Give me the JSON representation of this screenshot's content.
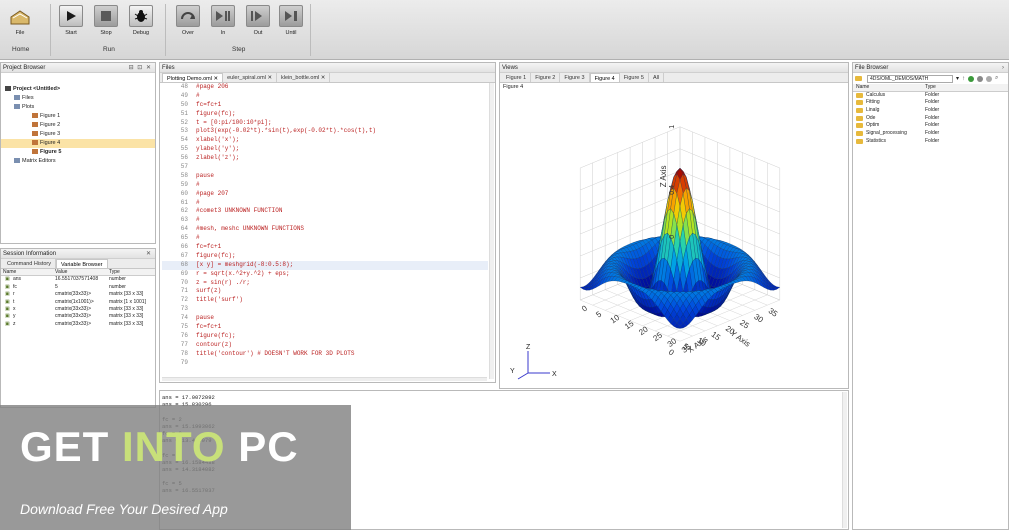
{
  "ribbon": {
    "buttons": [
      {
        "label": "File"
      },
      {
        "label": "Start"
      },
      {
        "label": "Stop"
      },
      {
        "label": "Debug"
      },
      {
        "label": "Over"
      },
      {
        "label": "In"
      },
      {
        "label": "Out"
      },
      {
        "label": "Until"
      }
    ],
    "groups": {
      "home": "Home",
      "run": "Run",
      "step": "Step"
    }
  },
  "project_browser": {
    "title": "Project Browser",
    "tree": [
      {
        "label": "Project <Untitled>",
        "bold": true,
        "depth": 0
      },
      {
        "label": "Files",
        "depth": 1
      },
      {
        "label": "Plots",
        "depth": 1
      },
      {
        "label": "Figure 1",
        "depth": 3
      },
      {
        "label": "Figure 2",
        "depth": 3
      },
      {
        "label": "Figure 3",
        "depth": 3
      },
      {
        "label": "Figure 4",
        "depth": 3,
        "selected": true
      },
      {
        "label": "Figure 5",
        "depth": 3,
        "bold": true
      },
      {
        "label": "Matrix Editors",
        "depth": 1
      }
    ]
  },
  "session": {
    "title": "Session Information",
    "tabs": [
      "Command History",
      "Variable Browser"
    ],
    "columns": [
      "Name",
      "Value",
      "Type"
    ],
    "rows": [
      {
        "name": "ans",
        "value": "16.5517037571408",
        "type": "number"
      },
      {
        "name": "fc",
        "value": "5",
        "type": "number"
      },
      {
        "name": "r",
        "value": "cmatrix(33x33)>",
        "type": "matrix [33 x 33]"
      },
      {
        "name": "t",
        "value": "cmatrix(1x1001)>",
        "type": "matrix [1 x 1001]"
      },
      {
        "name": "x",
        "value": "cmatrix(33x33)>",
        "type": "matrix [33 x 33]"
      },
      {
        "name": "y",
        "value": "cmatrix(33x33)>",
        "type": "matrix [33 x 33]"
      },
      {
        "name": "z",
        "value": "cmatrix(33x33)>",
        "type": "matrix [33 x 33]"
      }
    ]
  },
  "files": {
    "title": "Files",
    "tabs": [
      "Plotting Demo.oml",
      "euler_spiral.oml",
      "klein_bottle.oml"
    ],
    "lines": [
      {
        "n": "48",
        "t": "#page 206"
      },
      {
        "n": "49",
        "t": "#"
      },
      {
        "n": "50",
        "t": "fc=fc+1"
      },
      {
        "n": "51",
        "t": "figure(fc);"
      },
      {
        "n": "52",
        "t": "t = [0:pi/100:10*pi];"
      },
      {
        "n": "53",
        "t": "plot3(exp(-0.02*t).*sin(t),exp(-0.02*t).*cos(t),t)"
      },
      {
        "n": "54",
        "t": "xlabel('x');"
      },
      {
        "n": "55",
        "t": "ylabel('y');"
      },
      {
        "n": "56",
        "t": "zlabel('z');"
      },
      {
        "n": "57",
        "t": ""
      },
      {
        "n": "58",
        "t": "pause"
      },
      {
        "n": "59",
        "t": "#"
      },
      {
        "n": "60",
        "t": "#page 207"
      },
      {
        "n": "61",
        "t": "#"
      },
      {
        "n": "62",
        "t": "#comet3                UNKNOWN FUNCTION"
      },
      {
        "n": "63",
        "t": "#"
      },
      {
        "n": "64",
        "t": "#mesh, meshc           UNKNOWN FUNCTIONS"
      },
      {
        "n": "65",
        "t": "#"
      },
      {
        "n": "66",
        "t": "fc=fc+1"
      },
      {
        "n": "67",
        "t": "figure(fc);"
      },
      {
        "n": "68",
        "t": "[x y] = meshgrid(-8:0.5:8);",
        "hl": true
      },
      {
        "n": "69",
        "t": "r = sqrt(x.^2+y.^2) + eps;"
      },
      {
        "n": "70",
        "t": "z = sin(r) ./r;"
      },
      {
        "n": "71",
        "t": "surf(z)"
      },
      {
        "n": "72",
        "t": "title('surf')"
      },
      {
        "n": "73",
        "t": ""
      },
      {
        "n": "74",
        "t": "pause"
      },
      {
        "n": "75",
        "t": "fc=fc+1"
      },
      {
        "n": "76",
        "t": "figure(fc);"
      },
      {
        "n": "77",
        "t": "contour(z)"
      },
      {
        "n": "78",
        "t": "title('contour')              # DOESN'T WORK FOR 3D PLOTS"
      },
      {
        "n": "79",
        "t": ""
      }
    ]
  },
  "views": {
    "title": "Views",
    "tabs": [
      "Figure 1",
      "Figure 2",
      "Figure 3",
      "Figure 4",
      "Figure 5",
      "All"
    ],
    "active_tab": 3,
    "figure_label": "Figure 4"
  },
  "chart_data": {
    "type": "surface",
    "title": "",
    "xlabel": "X Axis",
    "ylabel": "Y Axis",
    "zlabel": "Z Axis",
    "x_ticks": [
      "0",
      "5",
      "10",
      "15",
      "20",
      "25",
      "30",
      "35"
    ],
    "y_ticks": [
      "35",
      "30",
      "25",
      "20",
      "15",
      "10",
      "5",
      "0"
    ],
    "z_ticks": [
      "0",
      "0.4",
      "1"
    ],
    "xlim": [
      0,
      35
    ],
    "ylim": [
      0,
      35
    ],
    "zlim": [
      -0.2,
      1
    ],
    "function": "z = sin(r)/r, r = sqrt(x^2+y^2), meshgrid(-8:0.5:8)",
    "grid": true,
    "triad": {
      "x": "X",
      "y": "Y",
      "z": "Z"
    }
  },
  "console": {
    "lines": [
      "ans = 17.0072092",
      "ans = 15.830296",
      "",
      "fc = 2",
      "ans = 15.1993062",
      "fc = 3",
      "ans = 13.415979",
      "",
      "fc = 4",
      "ans = 16.1584488",
      "ans = 14.3184082",
      "",
      "fc = 5",
      "ans = 16.5517037"
    ]
  },
  "file_browser": {
    "title": "File Browser",
    "path": "4DS/OML_DEMOS/MATH",
    "columns": [
      "Name",
      "Type"
    ],
    "rows": [
      {
        "name": "Calculus",
        "type": "Folder"
      },
      {
        "name": "Fitting",
        "type": "Folder"
      },
      {
        "name": "Linalg",
        "type": "Folder"
      },
      {
        "name": "Ode",
        "type": "Folder"
      },
      {
        "name": "Optim",
        "type": "Folder"
      },
      {
        "name": "Signal_processing",
        "type": "Folder"
      },
      {
        "name": "Statistics",
        "type": "Folder"
      }
    ]
  },
  "watermark": {
    "title_a": "GET ",
    "title_b": "INTO",
    "title_c": " PC",
    "subtitle": "Download Free Your Desired App"
  },
  "colors": {
    "accent": "#fbe3a6",
    "watermark_accent": "#c8e07a",
    "code_red": "#b22222"
  }
}
